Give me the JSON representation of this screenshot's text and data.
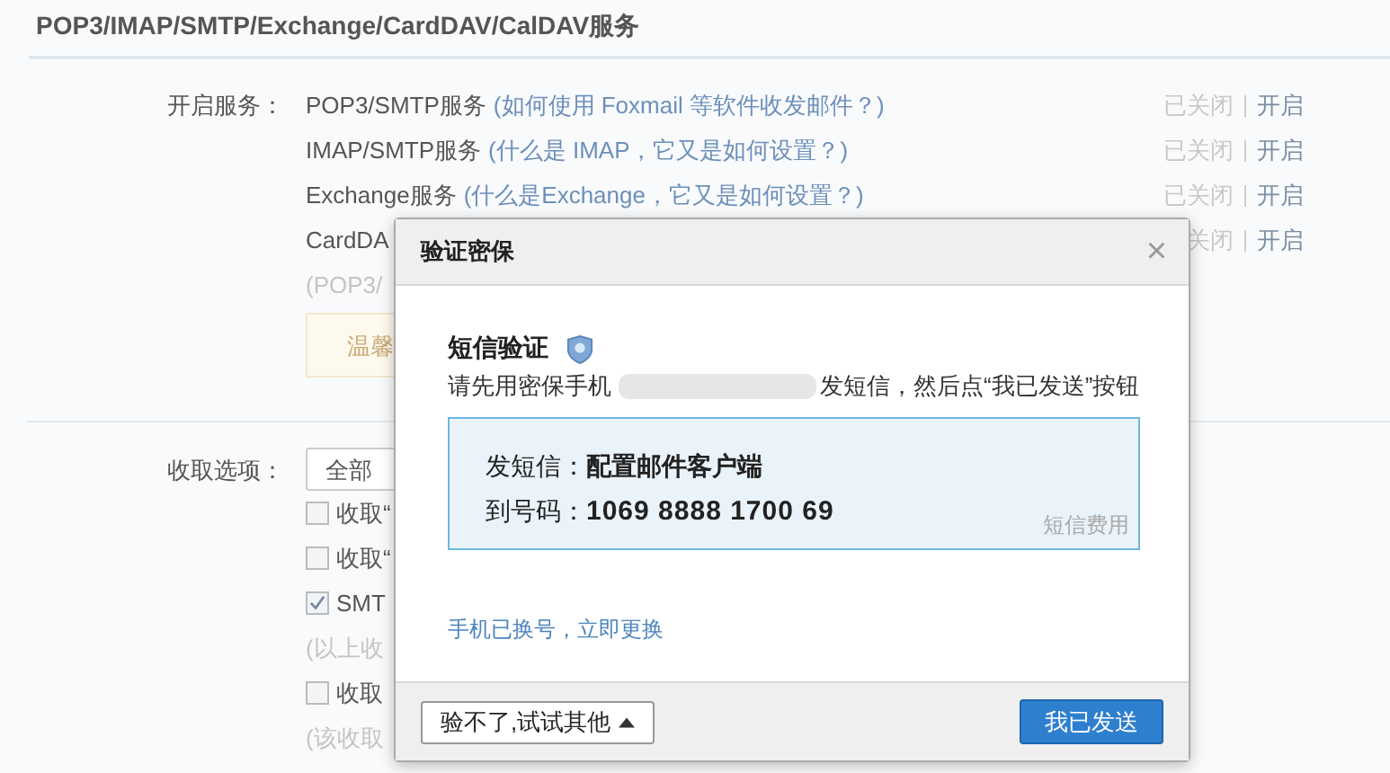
{
  "page_title": "POP3/IMAP/SMTP/Exchange/CardDAV/CalDAV服务",
  "services": {
    "label": "开启服务：",
    "rows": [
      {
        "name": "POP3/SMTP服务",
        "help": "(如何使用 Foxmail 等软件收发邮件？)",
        "status": "已关闭",
        "action": "开启"
      },
      {
        "name": "IMAP/SMTP服务",
        "help": "(什么是 IMAP，它又是如何设置？)",
        "status": "已关闭",
        "action": "开启"
      },
      {
        "name": "Exchange服务",
        "help": "(什么是Exchange，它又是如何设置？)",
        "status": "已关闭",
        "action": "开启"
      },
      {
        "name": "CardDA",
        "status": "关闭",
        "action": "开启"
      }
    ],
    "note": "(POP3/",
    "notice": "温馨"
  },
  "receive": {
    "label": "收取选项：",
    "select": "全部",
    "options": [
      {
        "kind": "checkbox",
        "label": "收取“",
        "checked": false
      },
      {
        "kind": "checkbox",
        "label": "收取“",
        "checked": false
      },
      {
        "kind": "checkbox",
        "label": "SMT",
        "checked": true
      },
      {
        "kind": "note",
        "label": "(以上收"
      },
      {
        "kind": "checkbox",
        "label": "收取",
        "checked": false
      },
      {
        "kind": "note",
        "label": "(该收取"
      }
    ]
  },
  "dialog": {
    "title": "验证密保",
    "close": "×",
    "heading": "短信验证",
    "instruction_before": "请先用密保手机",
    "instruction_after": "发短信，然后点“我已发送”按钮",
    "sms": {
      "content_label": "发短信：",
      "content": "配置邮件客户端",
      "number_label": "到号码：",
      "number": "1069 8888 1700 69",
      "fee_link": "短信费用"
    },
    "change_phone_link": "手机已换号，立即更换",
    "alt_button": "验不了,试试其他",
    "confirm_button": "我已发送"
  }
}
